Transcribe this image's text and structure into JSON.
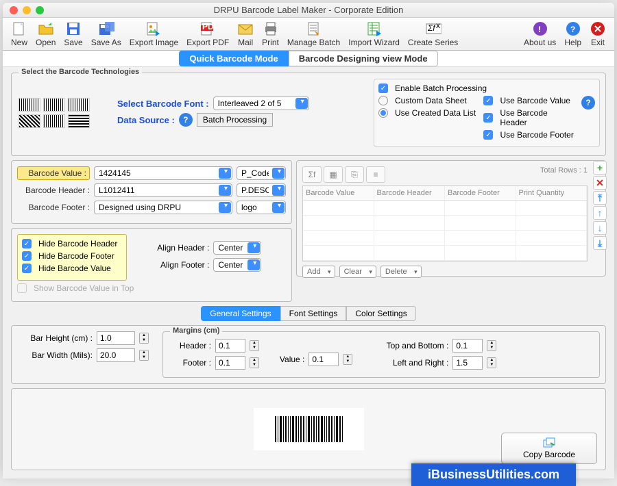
{
  "window": {
    "title": "DRPU Barcode Label Maker - Corporate Edition"
  },
  "toolbar": {
    "new": "New",
    "open": "Open",
    "save": "Save",
    "saveas": "Save As",
    "exportimg": "Export Image",
    "exportpdf": "Export PDF",
    "mail": "Mail",
    "print": "Print",
    "managebatch": "Manage Batch",
    "importwiz": "Import Wizard",
    "createseries": "Create Series",
    "about": "About us",
    "help": "Help",
    "exit": "Exit"
  },
  "modes": {
    "quick": "Quick Barcode Mode",
    "design": "Barcode Designing view Mode"
  },
  "tech": {
    "title": "Select the Barcode Technologies",
    "fontlbl": "Select Barcode Font :",
    "fontval": "Interleaved 2 of 5",
    "dslbl": "Data Source :",
    "dsval": "Batch Processing",
    "enable": "Enable Batch Processing",
    "custom": "Custom Data Sheet",
    "created": "Use Created Data List",
    "usebv": "Use Barcode Value",
    "usebh": "Use Barcode Header",
    "usebf": "Use Barcode Footer"
  },
  "fields": {
    "bvlbl": "Barcode Value :",
    "bvval": "1424145",
    "bvcol": "P_Code",
    "bhlbl": "Barcode Header :",
    "bhval": "L1012411",
    "bhcol": "P.DESC",
    "bflbl": "Barcode Footer :",
    "bfval": "Designed using DRPU",
    "bfcol": "logo"
  },
  "hide": {
    "hh": "Hide Barcode Header",
    "hf": "Hide Barcode Footer",
    "hv": "Hide Barcode Value",
    "top": "Show Barcode Value in Top"
  },
  "align": {
    "hlbl": "Align Header :",
    "hval": "Center",
    "flbl": "Align Footer :",
    "fval": "Center"
  },
  "tabletop": {
    "total": "Total Rows : 1",
    "cols": {
      "bv": "Barcode Value",
      "bh": "Barcode Header",
      "bf": "Barcode Footer",
      "pq": "Print Quantity"
    },
    "add": "Add",
    "clear": "Clear",
    "delete": "Delete"
  },
  "settabs": {
    "gen": "General Settings",
    "font": "Font Settings",
    "color": "Color Settings"
  },
  "gen": {
    "bh": "Bar Height (cm) :",
    "bhv": "1.0",
    "bw": "Bar Width (Mils):",
    "bwv": "20.0",
    "margins": "Margins (cm)",
    "mhead": "Header :",
    "mhv": "0.1",
    "mfoot": "Footer :",
    "mfv": "0.1",
    "mval": "Value :",
    "mvv": "0.1",
    "mtb": "Top and Bottom :",
    "mtbv": "0.1",
    "mlr": "Left and Right :",
    "mlrv": "1.5"
  },
  "copy": "Copy Barcode",
  "brand": "iBusinessUtilities.com"
}
